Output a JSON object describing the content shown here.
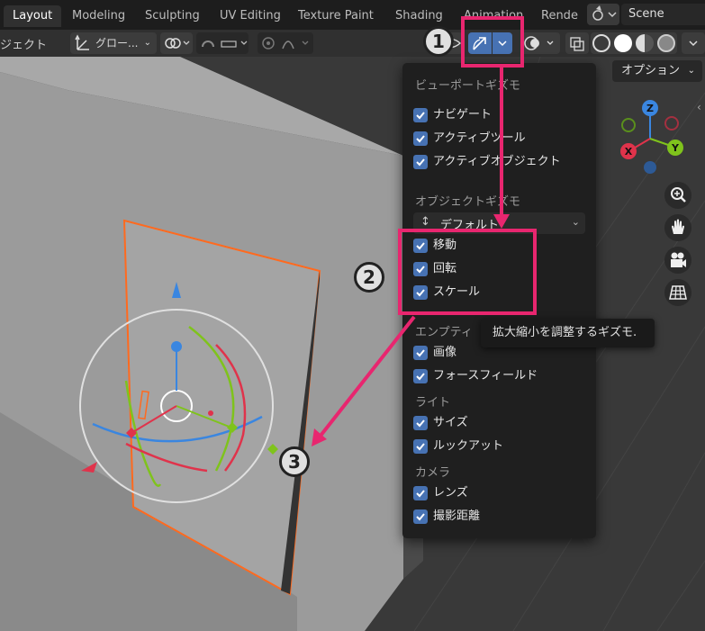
{
  "tabs": [
    "Layout",
    "Modeling",
    "Sculpting",
    "UV Editing",
    "Texture Paint",
    "Shading",
    "Animation",
    "Rende"
  ],
  "scene": "Scene",
  "header": {
    "left_text": "ジェクト",
    "orientation": "グロー..."
  },
  "options_label": "オプション",
  "nav_gizmo": {
    "z": "Z",
    "x": "X",
    "y": "Y"
  },
  "popup": {
    "title": "ビューポートギズモ",
    "viewport_items": [
      "ナビゲート",
      "アクティブツール",
      "アクティブオブジェクト"
    ],
    "object_gizmo_title": "オブジェクトギズモ",
    "dropdown_value": "デフォルト",
    "object_items": [
      "移動",
      "回転",
      "スケール"
    ],
    "empty_title": "エンプティ",
    "empty_items": [
      "画像",
      "フォースフィールド"
    ],
    "light_title": "ライト",
    "light_items": [
      "サイズ",
      "ルックアット"
    ],
    "camera_title": "カメラ",
    "camera_items": [
      "レンズ",
      "撮影距離"
    ]
  },
  "tooltip": "拡大縮小を調整するギズモ.",
  "annotations": [
    "1",
    "2",
    "3"
  ],
  "colors": {
    "accent_blue": "#4772b3",
    "annotation_pink": "#e8266f",
    "axis_x": "#e0334b",
    "axis_y": "#7fc31c",
    "axis_z": "#3a86e0",
    "selection_orange": "#ff6a1f"
  }
}
